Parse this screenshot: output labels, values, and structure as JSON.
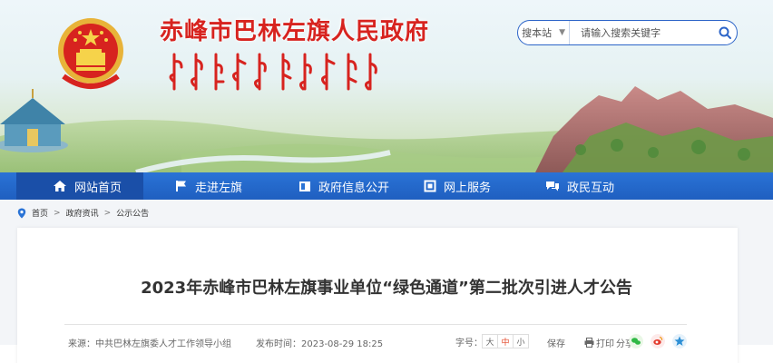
{
  "site": {
    "title": "赤峰市巴林左旗人民政府"
  },
  "search": {
    "scope": "搜本站",
    "placeholder": "请输入搜索关键字"
  },
  "nav": {
    "items": [
      {
        "label": "网站首页",
        "icon": "home-icon",
        "active": true
      },
      {
        "label": "走进左旗",
        "icon": "flag-icon",
        "active": false
      },
      {
        "label": "政府信息公开",
        "icon": "folder-icon",
        "active": false
      },
      {
        "label": "网上服务",
        "icon": "document-icon",
        "active": false
      },
      {
        "label": "政民互动",
        "icon": "chat-icon",
        "active": false
      }
    ]
  },
  "breadcrumb": {
    "items": [
      "首页",
      "政府资讯",
      "公示公告"
    ],
    "separator": ">"
  },
  "article": {
    "title": "2023年赤峰市巴林左旗事业单位“绿色通道”第二批次引进人才公告",
    "source": "来源：中共巴林左旗委人才工作领导小组",
    "date": "发布时间：2023-08-29 18:25",
    "fontsize_label": "字号：",
    "fontsize_options": [
      "大",
      "中",
      "小"
    ],
    "fontsize_selected": "中",
    "save_label": "保存",
    "print_label": "打印",
    "share_label": "分享："
  },
  "colors": {
    "brand_red": "#d7231f",
    "nav_blue": "#2a73d6",
    "nav_active": "#1a4fa8",
    "search_border": "#2c64c8"
  }
}
